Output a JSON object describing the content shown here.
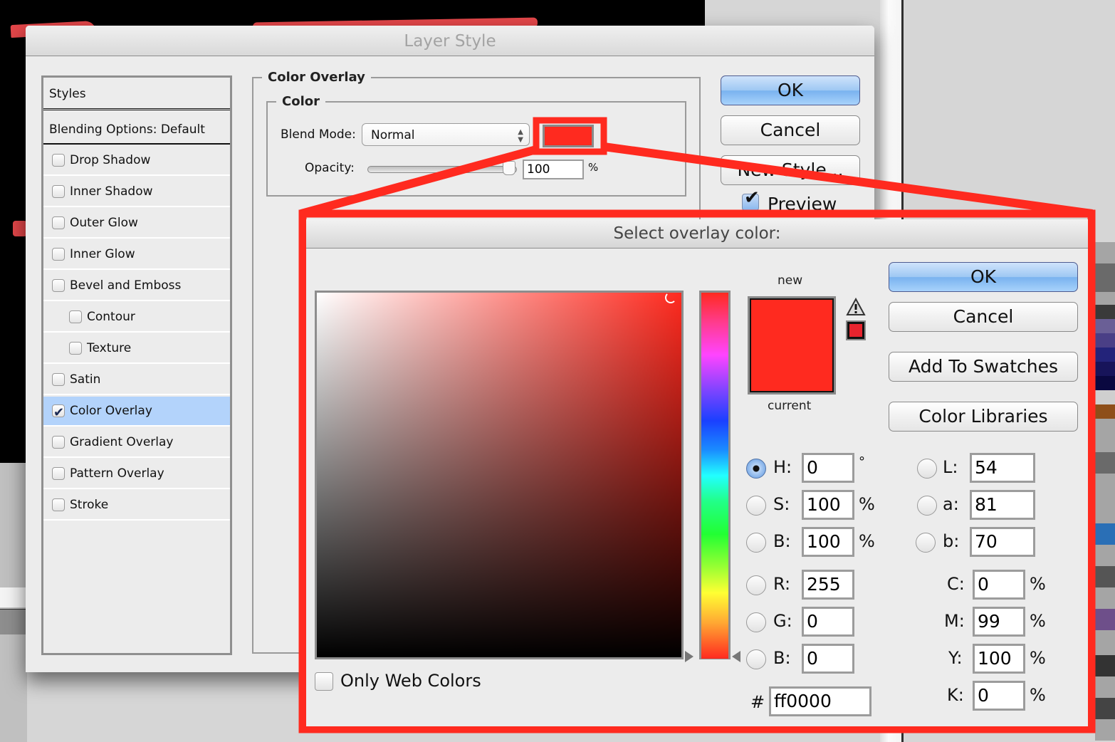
{
  "layer_style": {
    "title": "Layer Style",
    "styles_header": "Styles",
    "blending_options": "Blending Options: Default",
    "items": [
      {
        "label": "Drop Shadow",
        "checked": false,
        "indent": false
      },
      {
        "label": "Inner Shadow",
        "checked": false,
        "indent": false
      },
      {
        "label": "Outer Glow",
        "checked": false,
        "indent": false
      },
      {
        "label": "Inner Glow",
        "checked": false,
        "indent": false
      },
      {
        "label": "Bevel and Emboss",
        "checked": false,
        "indent": false
      },
      {
        "label": "Contour",
        "checked": false,
        "indent": true
      },
      {
        "label": "Texture",
        "checked": false,
        "indent": true
      },
      {
        "label": "Satin",
        "checked": false,
        "indent": false
      },
      {
        "label": "Color Overlay",
        "checked": true,
        "indent": false,
        "selected": true
      },
      {
        "label": "Gradient Overlay",
        "checked": false,
        "indent": false
      },
      {
        "label": "Pattern Overlay",
        "checked": false,
        "indent": false
      },
      {
        "label": "Stroke",
        "checked": false,
        "indent": false
      }
    ],
    "section_title": "Color Overlay",
    "color_group": "Color",
    "blend_mode_label": "Blend Mode:",
    "blend_mode_value": "Normal",
    "overlay_color": "#ff2a1f",
    "opacity_label": "Opacity:",
    "opacity_value": "100",
    "opacity_unit": "%",
    "opacity_fraction": 1.0,
    "buttons": {
      "ok": "OK",
      "cancel": "Cancel",
      "new_style": "New Style..."
    },
    "preview_label": "Preview",
    "preview_checked": true
  },
  "color_picker": {
    "title": "Select overlay color:",
    "new_label": "new",
    "current_label": "current",
    "new_color": "#ff2a1f",
    "gamut_warning_color": "#e8242e",
    "buttons": {
      "ok": "OK",
      "cancel": "Cancel",
      "add_swatches": "Add To Swatches",
      "color_libraries": "Color Libraries"
    },
    "only_web_colors": "Only Web Colors",
    "only_web_colors_checked": false,
    "hsb": [
      {
        "label": "H:",
        "value": "0",
        "unit": "°",
        "selected": true
      },
      {
        "label": "S:",
        "value": "100",
        "unit": "%",
        "selected": false
      },
      {
        "label": "B:",
        "value": "100",
        "unit": "%",
        "selected": false
      }
    ],
    "rgb": [
      {
        "label": "R:",
        "value": "255"
      },
      {
        "label": "G:",
        "value": "0"
      },
      {
        "label": "B:",
        "value": "0"
      }
    ],
    "lab": [
      {
        "label": "L:",
        "value": "54"
      },
      {
        "label": "a:",
        "value": "81"
      },
      {
        "label": "b:",
        "value": "70"
      }
    ],
    "cmyk": [
      {
        "label": "C:",
        "value": "0",
        "unit": "%"
      },
      {
        "label": "M:",
        "value": "99",
        "unit": "%"
      },
      {
        "label": "Y:",
        "value": "100",
        "unit": "%"
      },
      {
        "label": "K:",
        "value": "0",
        "unit": "%"
      }
    ],
    "hex_label": "#",
    "hex_value": "ff0000"
  },
  "annotation": {
    "highlight_color": "#ff2a1f"
  }
}
